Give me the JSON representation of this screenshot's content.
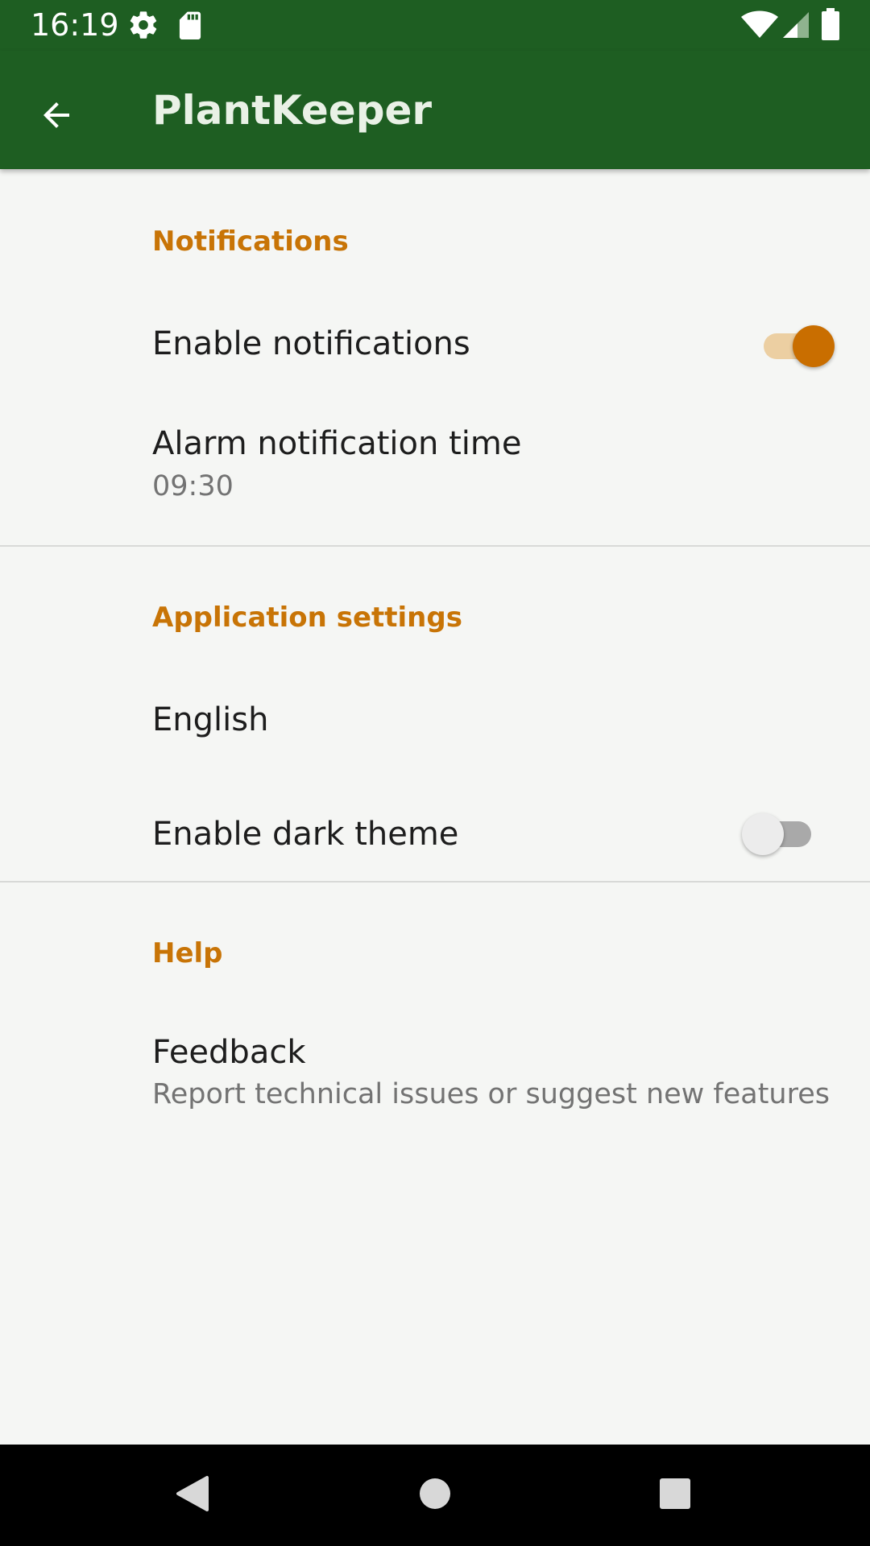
{
  "status_bar": {
    "time": "16:19",
    "icons_left": [
      "gear-icon",
      "sd-card-icon"
    ],
    "icons_right": [
      "wifi-icon",
      "cell-signal-icon",
      "battery-icon"
    ]
  },
  "app_bar": {
    "title": "PlantKeeper",
    "back_icon": "arrow-left-icon",
    "background_color": "#1e5e22"
  },
  "sections": [
    {
      "header": "Notifications",
      "items": [
        {
          "title": "Enable notifications",
          "switch": true
        },
        {
          "title": "Alarm notification time",
          "summary": "09:30"
        }
      ]
    },
    {
      "header": "Application settings",
      "items": [
        {
          "title": "English"
        },
        {
          "title": "Enable dark theme",
          "switch": false
        }
      ]
    },
    {
      "header": "Help",
      "items": [
        {
          "title": "Feedback",
          "summary": "Report technical issues or suggest new features"
        }
      ]
    }
  ],
  "colors": {
    "accent": "#c87406",
    "primary": "#1e5e22",
    "background": "#f5f6f4"
  },
  "nav_bar": {
    "buttons": [
      "back-triangle-icon",
      "home-circle-icon",
      "recents-square-icon"
    ]
  }
}
